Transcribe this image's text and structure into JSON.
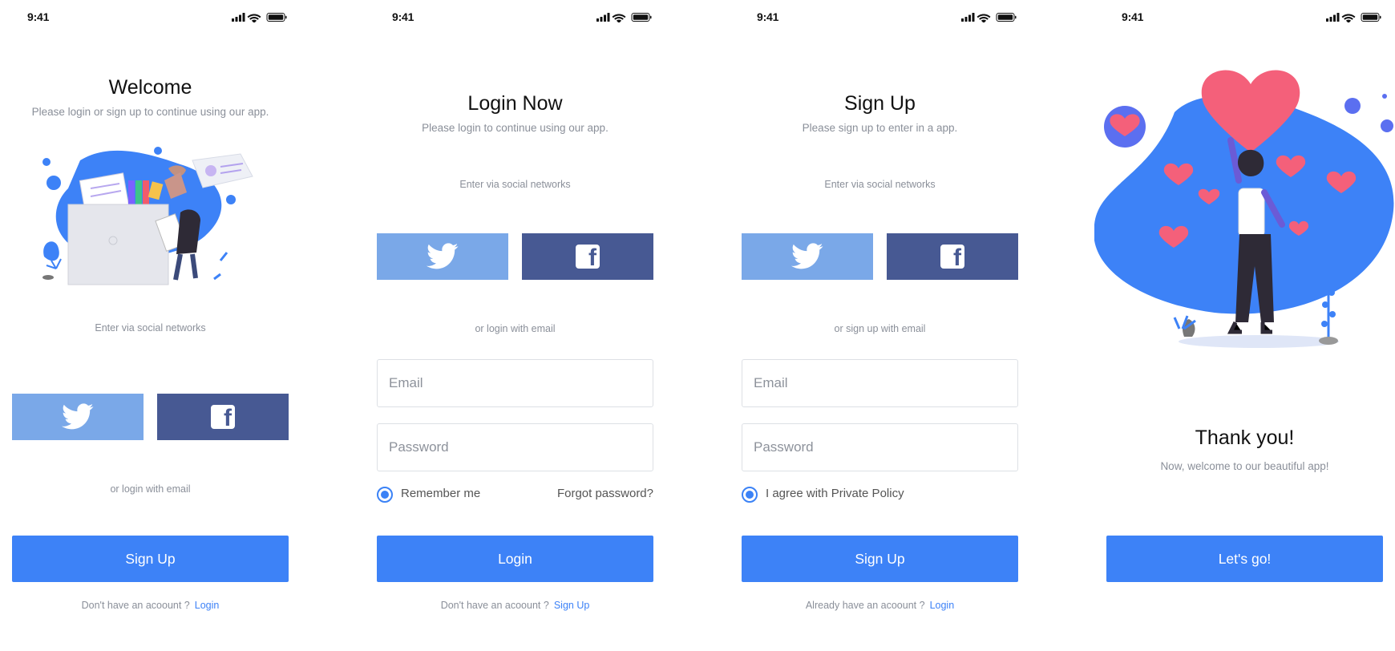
{
  "status_bar": {
    "time": "9:41"
  },
  "welcome": {
    "title": "Welcome",
    "subtitle": "Please login or sign up to continue using our app.",
    "social_label": "Enter via social networks",
    "email_label": "or login with email",
    "primary_button": "Sign Up",
    "footer_text": "Don't have an acoount ?",
    "footer_link": "Login"
  },
  "login": {
    "title": "Login Now",
    "subtitle": "Please login to continue using our app.",
    "social_label": "Enter via social networks",
    "email_label": "or login with email",
    "email_placeholder": "Email",
    "password_placeholder": "Password",
    "remember_label": "Remember me",
    "forgot_label": "Forgot password?",
    "primary_button": "Login",
    "footer_text": "Don't have an acoount ?",
    "footer_link": "Sign Up"
  },
  "signup": {
    "title": "Sign Up",
    "subtitle": "Please sign up to enter in a app.",
    "social_label": "Enter via social networks",
    "email_label": "or sign up with email",
    "email_placeholder": "Email",
    "password_placeholder": "Password",
    "agree_label": "I agree with Private Policy",
    "primary_button": "Sign Up",
    "footer_text": "Already have an acoount ?",
    "footer_link": "Login"
  },
  "thanks": {
    "title": "Thank you!",
    "subtitle": "Now, welcome to our beautiful app!",
    "primary_button": "Let's go!"
  },
  "icons": {
    "twitter": "twitter-icon",
    "facebook": "facebook-icon",
    "signal": "cellular-signal-icon",
    "wifi": "wifi-icon",
    "battery": "battery-icon"
  },
  "colors": {
    "accent": "#3d82f7",
    "twitter_button": "#7aa8e8",
    "facebook_button": "#475993",
    "muted_text": "#8a8f99",
    "heart": "#f4607a"
  }
}
